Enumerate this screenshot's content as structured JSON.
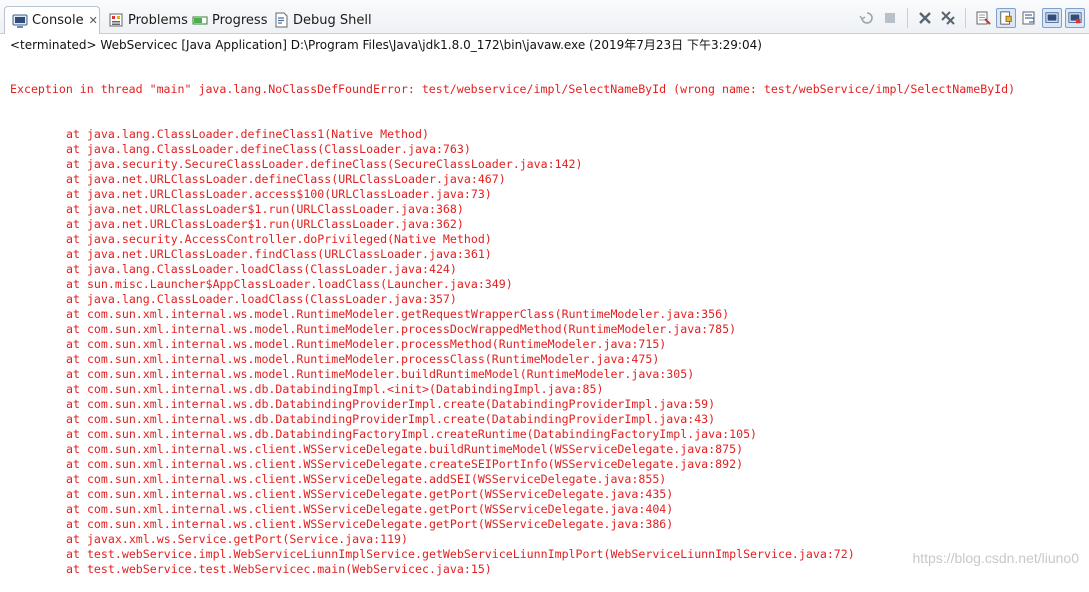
{
  "tabs": [
    {
      "label": "Console",
      "icon": "console-icon",
      "active": true,
      "closable": true
    },
    {
      "label": "Problems",
      "icon": "problems-icon"
    },
    {
      "label": "Progress",
      "icon": "progress-icon"
    },
    {
      "label": "Debug Shell",
      "icon": "debug-shell-icon"
    }
  ],
  "tab_close_glyph": "✕",
  "status_line": "<terminated> WebServicec [Java Application] D:\\Program Files\\Java\\jdk1.8.0_172\\bin\\javaw.exe (2019年7月23日 下午3:29:04)",
  "console": {
    "error_color": "#e32020",
    "header": "Exception in thread \"main\" java.lang.NoClassDefFoundError: test/webservice/impl/SelectNameById (wrong name: test/webService/impl/SelectNameById)",
    "frames": [
      "at java.lang.ClassLoader.defineClass1(Native Method)",
      "at java.lang.ClassLoader.defineClass(ClassLoader.java:763)",
      "at java.security.SecureClassLoader.defineClass(SecureClassLoader.java:142)",
      "at java.net.URLClassLoader.defineClass(URLClassLoader.java:467)",
      "at java.net.URLClassLoader.access$100(URLClassLoader.java:73)",
      "at java.net.URLClassLoader$1.run(URLClassLoader.java:368)",
      "at java.net.URLClassLoader$1.run(URLClassLoader.java:362)",
      "at java.security.AccessController.doPrivileged(Native Method)",
      "at java.net.URLClassLoader.findClass(URLClassLoader.java:361)",
      "at java.lang.ClassLoader.loadClass(ClassLoader.java:424)",
      "at sun.misc.Launcher$AppClassLoader.loadClass(Launcher.java:349)",
      "at java.lang.ClassLoader.loadClass(ClassLoader.java:357)",
      "at com.sun.xml.internal.ws.model.RuntimeModeler.getRequestWrapperClass(RuntimeModeler.java:356)",
      "at com.sun.xml.internal.ws.model.RuntimeModeler.processDocWrappedMethod(RuntimeModeler.java:785)",
      "at com.sun.xml.internal.ws.model.RuntimeModeler.processMethod(RuntimeModeler.java:715)",
      "at com.sun.xml.internal.ws.model.RuntimeModeler.processClass(RuntimeModeler.java:475)",
      "at com.sun.xml.internal.ws.model.RuntimeModeler.buildRuntimeModel(RuntimeModeler.java:305)",
      "at com.sun.xml.internal.ws.db.DatabindingImpl.<init>(DatabindingImpl.java:85)",
      "at com.sun.xml.internal.ws.db.DatabindingProviderImpl.create(DatabindingProviderImpl.java:59)",
      "at com.sun.xml.internal.ws.db.DatabindingProviderImpl.create(DatabindingProviderImpl.java:43)",
      "at com.sun.xml.internal.ws.db.DatabindingFactoryImpl.createRuntime(DatabindingFactoryImpl.java:105)",
      "at com.sun.xml.internal.ws.client.WSServiceDelegate.buildRuntimeModel(WSServiceDelegate.java:875)",
      "at com.sun.xml.internal.ws.client.WSServiceDelegate.createSEIPortInfo(WSServiceDelegate.java:892)",
      "at com.sun.xml.internal.ws.client.WSServiceDelegate.addSEI(WSServiceDelegate.java:855)",
      "at com.sun.xml.internal.ws.client.WSServiceDelegate.getPort(WSServiceDelegate.java:435)",
      "at com.sun.xml.internal.ws.client.WSServiceDelegate.getPort(WSServiceDelegate.java:404)",
      "at com.sun.xml.internal.ws.client.WSServiceDelegate.getPort(WSServiceDelegate.java:386)",
      "at javax.xml.ws.Service.getPort(Service.java:119)",
      "at test.webService.impl.WebServiceLiunnImplService.getWebServiceLiunnImplPort(WebServiceLiunnImplService.java:72)",
      "at test.webService.test.WebServicec.main(WebServicec.java:15)"
    ]
  },
  "toolbar": [
    {
      "icon": "terminate-relaunch-icon"
    },
    {
      "icon": "terminate-icon"
    },
    {
      "icon": "remove-launch-icon"
    },
    {
      "icon": "remove-all-terminated-icon"
    },
    {
      "icon": "clear-console-icon"
    },
    {
      "icon": "scroll-lock-icon",
      "toggled": true
    },
    {
      "icon": "word-wrap-icon"
    },
    {
      "icon": "show-console-on-stdout-icon",
      "toggled": true
    },
    {
      "icon": "show-console-on-stderr-icon",
      "toggled": true
    }
  ],
  "watermark": "https://blog.csdn.net/liuno0"
}
